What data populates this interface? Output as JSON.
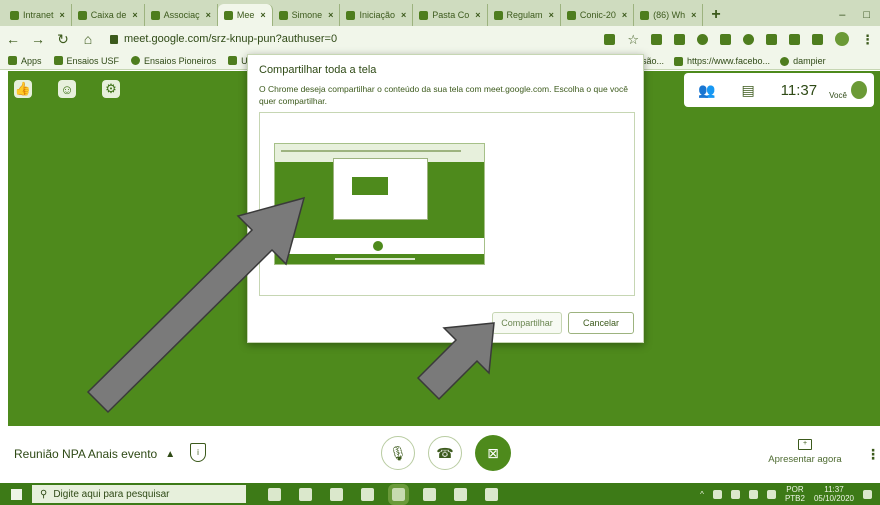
{
  "browser": {
    "tabs": [
      {
        "label": "Intranet",
        "active": false
      },
      {
        "label": "Caixa de",
        "active": false
      },
      {
        "label": "Associaç",
        "active": false
      },
      {
        "label": "Mee",
        "active": true
      },
      {
        "label": "Simone",
        "active": false
      },
      {
        "label": "Iniciação",
        "active": false
      },
      {
        "label": "Pasta Co",
        "active": false
      },
      {
        "label": "Regulam",
        "active": false
      },
      {
        "label": "Conic-20",
        "active": false
      },
      {
        "label": "(86) Wh",
        "active": false
      }
    ],
    "new_tab": "+",
    "address": "meet.google.com/srz-knup-pun?authuser=0"
  },
  "bookmarks": {
    "left": [
      "Apps",
      "Ensaios USF",
      "Ensaios Pioneiros",
      "USF - L"
    ],
    "right": [
      "são...",
      "https://www.facebo...",
      "dampier"
    ]
  },
  "meet_header": {
    "time": "11:37",
    "you_label": "Você"
  },
  "dialog": {
    "title": "Compartilhar toda a tela",
    "description": "O Chrome deseja compartilhar o conteúdo da sua tela com meet.google.com. Escolha o que você quer compartilhar.",
    "share_label": "Compartilhar",
    "cancel_label": "Cancelar"
  },
  "meeting": {
    "title": "Reunião NPA Anais evento",
    "present_label": "Apresentar agora"
  },
  "taskbar": {
    "search_placeholder": "Digite aqui para pesquisar",
    "language": "POR",
    "layout": "PTB2",
    "time": "11:37",
    "date": "05/10/2020"
  },
  "colors": {
    "meet_green": "#4e8a1c",
    "taskbar_green": "#3d7a17",
    "arrow_fill": "#7a7a7a"
  }
}
